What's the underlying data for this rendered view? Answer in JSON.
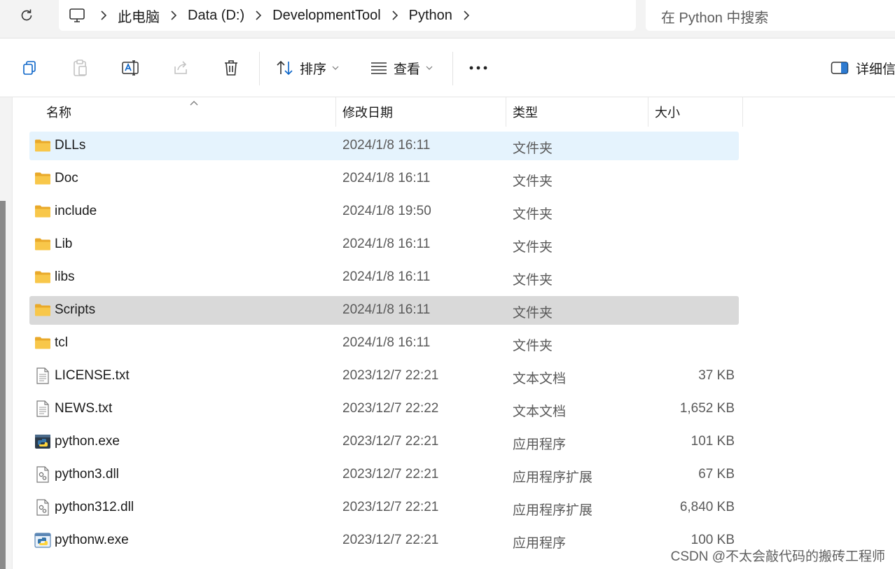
{
  "address_bar": {
    "breadcrumbs": [
      "此电脑",
      "Data (D:)",
      "DevelopmentTool",
      "Python"
    ],
    "search_placeholder": "在 Python 中搜索"
  },
  "toolbar": {
    "sort_label": "排序",
    "view_label": "查看",
    "details_label": "详细信"
  },
  "columns": {
    "name": "名称",
    "date": "修改日期",
    "type": "类型",
    "size": "大小"
  },
  "files": [
    {
      "name": "DLLs",
      "date": "2024/1/8 16:11",
      "type": "文件夹",
      "size": "",
      "icon": "folder-icon",
      "state": "hover"
    },
    {
      "name": "Doc",
      "date": "2024/1/8 16:11",
      "type": "文件夹",
      "size": "",
      "icon": "folder-icon",
      "state": ""
    },
    {
      "name": "include",
      "date": "2024/1/8 19:50",
      "type": "文件夹",
      "size": "",
      "icon": "folder-icon",
      "state": ""
    },
    {
      "name": "Lib",
      "date": "2024/1/8 16:11",
      "type": "文件夹",
      "size": "",
      "icon": "folder-icon",
      "state": ""
    },
    {
      "name": "libs",
      "date": "2024/1/8 16:11",
      "type": "文件夹",
      "size": "",
      "icon": "folder-icon",
      "state": ""
    },
    {
      "name": "Scripts",
      "date": "2024/1/8 16:11",
      "type": "文件夹",
      "size": "",
      "icon": "folder-icon",
      "state": "selected"
    },
    {
      "name": "tcl",
      "date": "2024/1/8 16:11",
      "type": "文件夹",
      "size": "",
      "icon": "folder-icon",
      "state": ""
    },
    {
      "name": "LICENSE.txt",
      "date": "2023/12/7 22:21",
      "type": "文本文档",
      "size": "37 KB",
      "icon": "text-file-icon",
      "state": ""
    },
    {
      "name": "NEWS.txt",
      "date": "2023/12/7 22:22",
      "type": "文本文档",
      "size": "1,652 KB",
      "icon": "text-file-icon",
      "state": ""
    },
    {
      "name": "python.exe",
      "date": "2023/12/7 22:21",
      "type": "应用程序",
      "size": "101 KB",
      "icon": "python-exe-icon",
      "state": ""
    },
    {
      "name": "python3.dll",
      "date": "2023/12/7 22:21",
      "type": "应用程序扩展",
      "size": "67 KB",
      "icon": "dll-file-icon",
      "state": ""
    },
    {
      "name": "python312.dll",
      "date": "2023/12/7 22:21",
      "type": "应用程序扩展",
      "size": "6,840 KB",
      "icon": "dll-file-icon",
      "state": ""
    },
    {
      "name": "pythonw.exe",
      "date": "2023/12/7 22:21",
      "type": "应用程序",
      "size": "100 KB",
      "icon": "pythonw-exe-icon",
      "state": ""
    }
  ],
  "watermark": "CSDN @不太会敲代码的搬砖工程师",
  "colors": {
    "hover_row": "#e5f3fd",
    "selected_row": "#d9d9d9",
    "folder": "#f8c74a",
    "accent": "#0a64c8"
  }
}
